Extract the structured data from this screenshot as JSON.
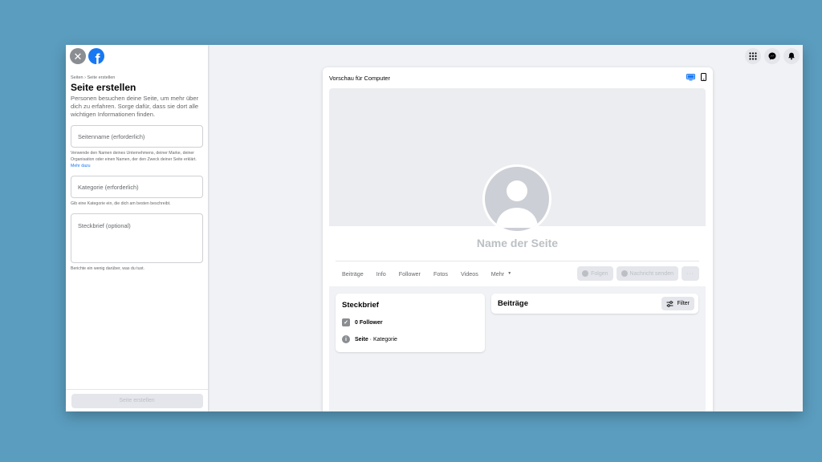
{
  "left_panel": {
    "breadcrumb": {
      "parent": "Seiten",
      "separator": "›",
      "current": "Seite erstellen"
    },
    "title": "Seite erstellen",
    "description": "Personen besuchen deine Seite, um mehr über dich zu erfahren. Sorge dafür, dass sie dort alle wichtigen Informationen finden.",
    "fields": {
      "name_placeholder": "Seitenname (erforderlich)",
      "name_hint": "Verwende den Namen deines Unternehmens, deiner Marke, deiner Organisation oder einen Namen, der den Zweck deiner Seite erklärt.",
      "name_hint_link": "Mehr dazu",
      "category_placeholder": "Kategorie (erforderlich)",
      "category_hint": "Gib eine Kategorie ein, die dich am besten beschreibt.",
      "bio_placeholder": "Steckbrief (optional)",
      "bio_hint": "Berichte ein wenig darüber, was du tust."
    },
    "create_button": "Seite erstellen"
  },
  "preview": {
    "title": "Vorschau für Computer",
    "page_name": "Name der Seite",
    "tabs": [
      "Beiträge",
      "Info",
      "Follower",
      "Fotos",
      "Videos",
      "Mehr"
    ],
    "actions": {
      "follow": "Folgen",
      "message": "Nachricht senden",
      "more": "···"
    },
    "intro": {
      "title": "Steckbrief",
      "followers": "0 Follower",
      "page_type_bold": "Seite",
      "page_type_rest": " · Kategorie"
    },
    "posts": {
      "title": "Beiträge",
      "filter": "Filter"
    }
  },
  "colors": {
    "brand": "#1877f2",
    "background": "#5b9dbf",
    "disabled_text": "#bcc0c4"
  },
  "icons": [
    "close-icon",
    "facebook-logo-icon",
    "apps-grid-icon",
    "messenger-icon",
    "bell-icon",
    "desktop-icon",
    "mobile-icon"
  ]
}
